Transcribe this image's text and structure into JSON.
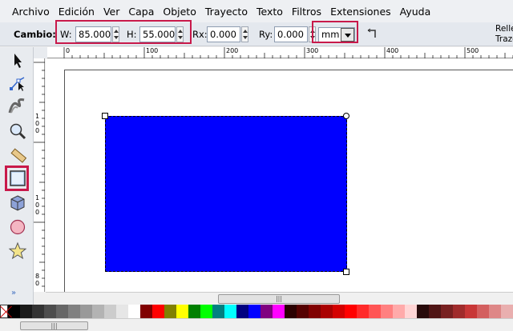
{
  "menu": [
    "Archivo",
    "Edición",
    "Ver",
    "Capa",
    "Objeto",
    "Trayecto",
    "Texto",
    "Filtros",
    "Extensiones",
    "Ayuda"
  ],
  "toolbar": {
    "cambio_label": "Cambio:",
    "w_label": "W:",
    "w_value": "85.000",
    "h_label": "H:",
    "h_value": "55.000",
    "rx_label": "Rx:",
    "rx_value": "0.000",
    "ry_label": "Ry:",
    "ry_value": "0.000",
    "unit": "mm",
    "relleno": "Relle",
    "trazo": "Trazo"
  },
  "hruler_labels": [
    "0",
    "100",
    "200",
    "300",
    "400",
    "500"
  ],
  "vruler_labels": [
    "1\n0\n0",
    "1\n0\n0",
    "8\n0"
  ],
  "tools": [
    "selector-tool",
    "node-tool",
    "tweak-tool",
    "zoom-tool",
    "measure-tool",
    "rectangle-tool",
    "3d-box-tool",
    "ellipse-tool",
    "star-tool"
  ],
  "active_tool": "rectangle-tool",
  "shape": {
    "fill": "#0000ff"
  },
  "scroll_grip": "|||",
  "palette": [
    "#000000",
    "#1a1a1a",
    "#333333",
    "#4d4d4d",
    "#666666",
    "#808080",
    "#999999",
    "#b3b3b3",
    "#cccccc",
    "#e6e6e6",
    "#ffffff",
    "#800000",
    "#ff0000",
    "#808000",
    "#ffff00",
    "#008000",
    "#00ff00",
    "#008080",
    "#00ffff",
    "#000080",
    "#0000ff",
    "#800080",
    "#ff00ff",
    "#2b0000",
    "#550000",
    "#800000",
    "#aa0000",
    "#d40000",
    "#ff0000",
    "#ff2a2a",
    "#ff5555",
    "#ff8080",
    "#ffaaaa",
    "#ffd5d5",
    "#280b0b",
    "#501616",
    "#782121",
    "#a02c2c",
    "#c83737",
    "#d35f5f",
    "#de8787",
    "#e9afaf"
  ]
}
